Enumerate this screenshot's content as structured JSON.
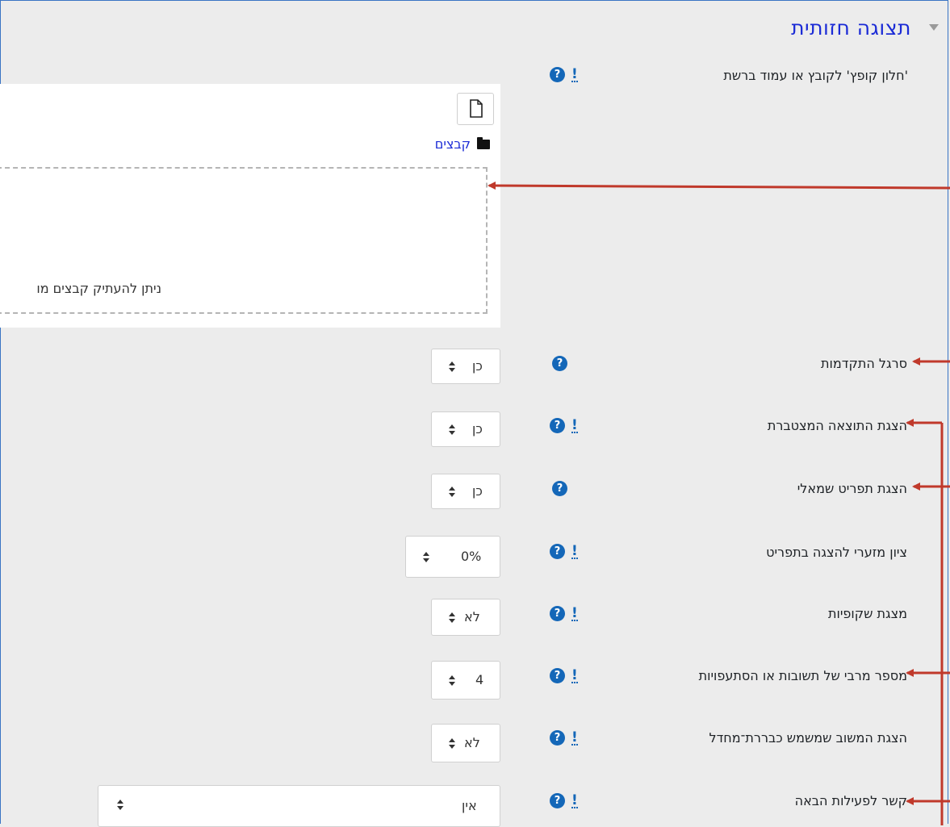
{
  "section": {
    "title": "תצוגה חזותית",
    "collapse_icon": "chevron-down-icon"
  },
  "popup": {
    "label": "'חלון קופץ' לקובץ או עמוד ברשת"
  },
  "filepicker": {
    "add_icon": "file-icon",
    "folder_label": "קבצים",
    "drop_hint": "ניתן להעתיק קבצים מו"
  },
  "help_icon_glyph": "?",
  "advanced_glyph": "!",
  "settings": [
    {
      "label": "סרגל התקדמות",
      "value": "כן",
      "advanced": false
    },
    {
      "label": "הצגת התוצאה המצטברת",
      "value": "כן",
      "advanced": true
    },
    {
      "label": "הצגת תפריט שמאלי",
      "value": "כן",
      "advanced": false
    },
    {
      "label": "ציון מזערי להצגה בתפריט",
      "value": "0%",
      "advanced": true
    },
    {
      "label": "מצגת שקופיות",
      "value": "לא",
      "advanced": true
    },
    {
      "label": "מספר מרבי של תשובות או הסתעפויות",
      "value": "4",
      "advanced": true
    },
    {
      "label": "הצגת המשוב שמשמש כבררת־מחדל",
      "value": "לא",
      "advanced": true
    },
    {
      "label": "קשר לפעילות הבאה",
      "value": "אין",
      "advanced": true
    }
  ],
  "colors": {
    "accent": "#1b2bd6",
    "help": "#1467b8",
    "annotation": "#c0392b",
    "background": "#ececec"
  }
}
